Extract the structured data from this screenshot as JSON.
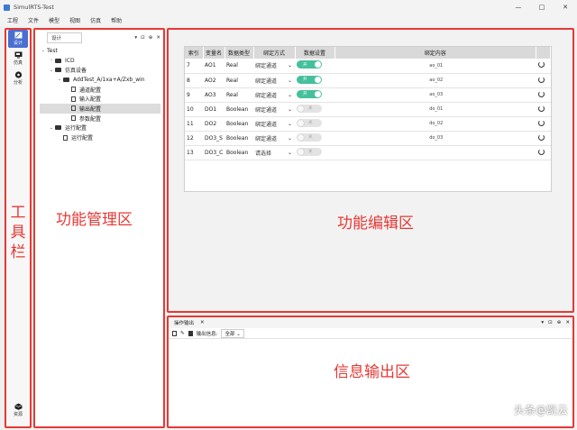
{
  "window": {
    "title": "SimulRTS-Test",
    "controls": [
      "—",
      "□",
      "✕"
    ]
  },
  "menu": [
    "工程",
    "文件",
    "模型",
    "视图",
    "仿真",
    "帮助"
  ],
  "toolbar": {
    "items": [
      {
        "label": "设计",
        "icon": "design-icon",
        "active": true
      },
      {
        "label": "仿真",
        "icon": "monitor-icon",
        "active": false
      },
      {
        "label": "分析",
        "icon": "analysis-icon",
        "active": false
      }
    ],
    "bottom_item": {
      "label": "资源",
      "icon": "resource-cube-icon"
    }
  },
  "tree_panel": {
    "tab_label": "设计",
    "header_icons": [
      "▾",
      "⊡",
      "⊕",
      "✕"
    ],
    "nodes": [
      {
        "label": "Test",
        "level": 0,
        "kind": "root",
        "caret": "⌄"
      },
      {
        "label": "ICD",
        "level": 1,
        "kind": "folder",
        "caret": "›"
      },
      {
        "label": "仿真设备",
        "level": 1,
        "kind": "folder",
        "caret": "⌄"
      },
      {
        "label": "AddTest_A/1xa+A/Zxb_win",
        "level": 2,
        "kind": "device",
        "caret": "⌄"
      },
      {
        "label": "通道配置",
        "level": 3,
        "kind": "file",
        "caret": ""
      },
      {
        "label": "输入配置",
        "level": 3,
        "kind": "file",
        "caret": ""
      },
      {
        "label": "输出配置",
        "level": 3,
        "kind": "file",
        "caret": "",
        "selected": true
      },
      {
        "label": "参数配置",
        "level": 3,
        "kind": "file",
        "caret": ""
      },
      {
        "label": "运行配置",
        "level": 1,
        "kind": "folder",
        "caret": "⌄"
      },
      {
        "label": "运行配置",
        "level": 2,
        "kind": "file",
        "caret": ""
      }
    ]
  },
  "table": {
    "headers": [
      "索引",
      "变量名",
      "数据类型",
      "绑定方式",
      "数据设置",
      "绑定内容",
      ""
    ],
    "rows": [
      {
        "idx": "7",
        "name": "AO1",
        "type": "Real",
        "bind": "绑定通道",
        "switch_on": true,
        "switch_text": "开",
        "content": "ao_01"
      },
      {
        "idx": "8",
        "name": "AO2",
        "type": "Real",
        "bind": "绑定通道",
        "switch_on": true,
        "switch_text": "开",
        "content": "ao_02"
      },
      {
        "idx": "9",
        "name": "AO3",
        "type": "Real",
        "bind": "绑定通道",
        "switch_on": true,
        "switch_text": "开",
        "content": "ao_03"
      },
      {
        "idx": "10",
        "name": "DO1",
        "type": "Boolean",
        "bind": "绑定通道",
        "switch_on": false,
        "switch_text": "关",
        "content": "do_01"
      },
      {
        "idx": "11",
        "name": "DO2",
        "type": "Boolean",
        "bind": "绑定通道",
        "switch_on": false,
        "switch_text": "关",
        "content": "do_02"
      },
      {
        "idx": "12",
        "name": "DO3_S",
        "type": "Boolean",
        "bind": "绑定通道",
        "switch_on": false,
        "switch_text": "关",
        "content": "do_03"
      },
      {
        "idx": "13",
        "name": "DO3_C",
        "type": "Boolean",
        "bind": "请选择",
        "switch_on": false,
        "switch_text": "关",
        "content": ""
      }
    ]
  },
  "output_panel": {
    "tab_label": "操作输出",
    "close": "✕",
    "header_icons": [
      "▾",
      "⊡",
      "⊕",
      "✕"
    ],
    "filter_label": "输出信息:",
    "filter_value": "全部"
  },
  "overlay_labels": {
    "toolbar": "工具栏",
    "tree": "功能管理区",
    "edit": "功能编辑区",
    "output": "信息输出区"
  },
  "watermark": "头条@凯云",
  "colors": {
    "accent": "#4a6fd1",
    "switch_on": "#45c09c",
    "annotation_red": "#e53935"
  }
}
